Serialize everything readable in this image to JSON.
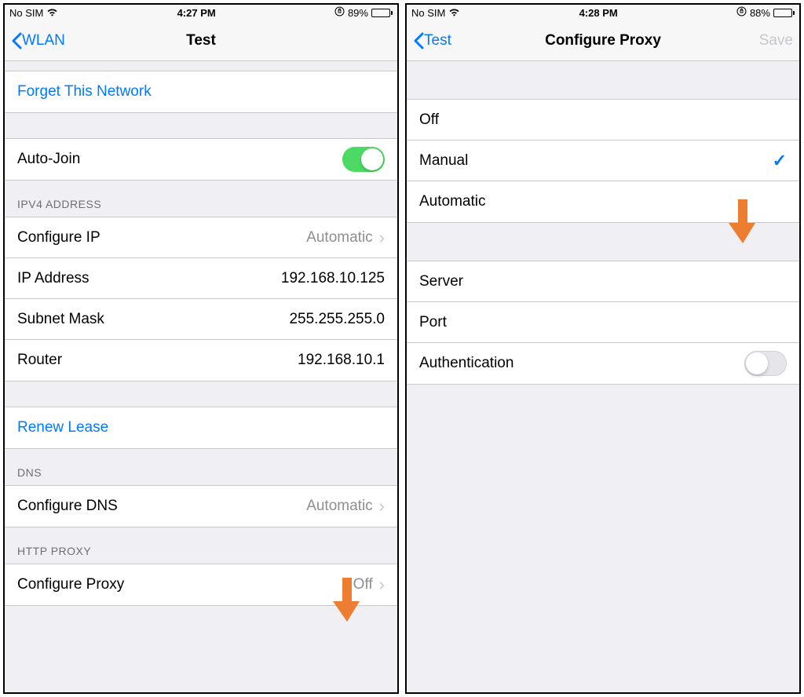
{
  "left": {
    "status": {
      "carrier": "No SIM",
      "time": "4:27 PM",
      "battery_pct": "89%"
    },
    "nav": {
      "back": "WLAN",
      "title": "Test"
    },
    "forget": "Forget This Network",
    "auto_join": {
      "label": "Auto-Join",
      "on": true
    },
    "ipv4_header": "IPV4 ADDRESS",
    "ipv4": {
      "configure_ip": {
        "label": "Configure IP",
        "value": "Automatic"
      },
      "ip_address": {
        "label": "IP Address",
        "value": "192.168.10.125"
      },
      "subnet_mask": {
        "label": "Subnet Mask",
        "value": "255.255.255.0"
      },
      "router": {
        "label": "Router",
        "value": "192.168.10.1"
      }
    },
    "renew_lease": "Renew Lease",
    "dns_header": "DNS",
    "dns": {
      "label": "Configure DNS",
      "value": "Automatic"
    },
    "proxy_header": "HTTP PROXY",
    "proxy": {
      "label": "Configure Proxy",
      "value": "Off"
    }
  },
  "right": {
    "status": {
      "carrier": "No SIM",
      "time": "4:28 PM",
      "battery_pct": "88%"
    },
    "nav": {
      "back": "Test",
      "title": "Configure Proxy",
      "save": "Save"
    },
    "modes": {
      "off": "Off",
      "manual": "Manual",
      "automatic": "Automatic",
      "selected": "manual"
    },
    "fields": {
      "server": "Server",
      "port": "Port",
      "auth": {
        "label": "Authentication",
        "on": false
      }
    }
  }
}
